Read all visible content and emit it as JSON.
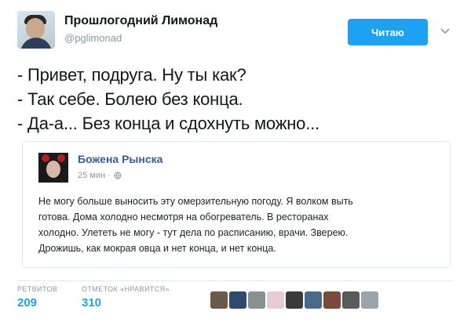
{
  "author": {
    "name": "Прошлогодний Лимонад",
    "handle": "@pglimonad"
  },
  "follow_button": {
    "label": "Читаю"
  },
  "tweet": {
    "lines": [
      "- Привет, подруга. Ну ты как?",
      "- Так себе. Болею без конца.",
      "- Да-а... Без конца и сдохнуть можно..."
    ]
  },
  "quoted_post": {
    "name": "Божена Рынска",
    "time": "25 мин ·",
    "text_lines": [
      "Не могу больше выносить эту омерзительную погоду. Я волком выть",
      "готова. Дома холодно несмотря на обогреватель. В ресторанах",
      "холодно. Улететь не могу - тут дела по расписанию, врачи. Зверею.",
      "Дрожишь, как мокрая овца и нет конца, и нет конца."
    ]
  },
  "stats": {
    "retweets": {
      "label": "РЕТВИТОВ",
      "value": "209"
    },
    "likes": {
      "label": "ОТМЕТОК «НРАВИТСЯ»",
      "value": "310"
    }
  },
  "likers": [
    {
      "name": "liker-1",
      "color": "#6b5a4a"
    },
    {
      "name": "liker-2",
      "color": "#2e4a6e"
    },
    {
      "name": "liker-3",
      "color": "#8a8f94"
    },
    {
      "name": "liker-4",
      "color": "#e8c9d6"
    },
    {
      "name": "liker-5",
      "color": "#3a3a3a"
    },
    {
      "name": "liker-6",
      "color": "#4a6a8a"
    },
    {
      "name": "liker-7",
      "color": "#7a4a3a"
    },
    {
      "name": "liker-8",
      "color": "#5a5a5a"
    },
    {
      "name": "liker-9",
      "color": "#9aa4ac"
    }
  ],
  "colors": {
    "accent": "#1da1f2",
    "facebook_name": "#3b5998",
    "muted": "#8899a6"
  }
}
